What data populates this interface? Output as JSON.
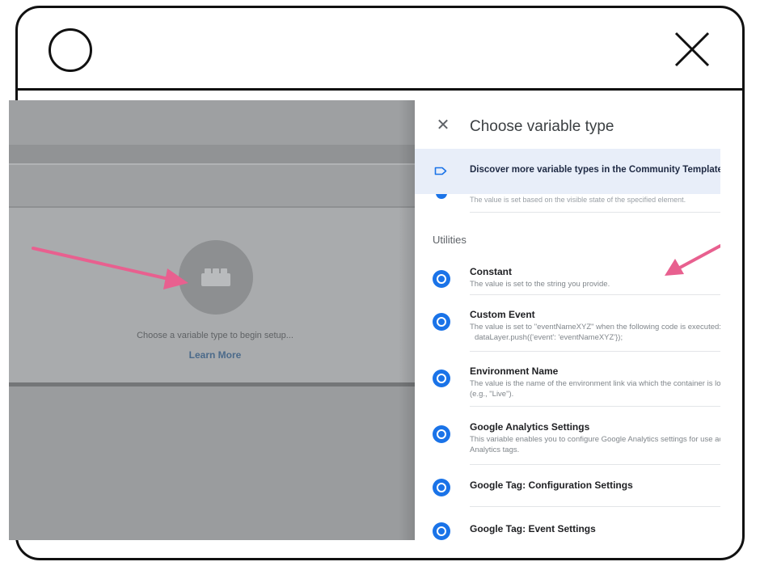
{
  "window": {
    "circle_icon": "circle-icon",
    "close_icon": "close-x-icon"
  },
  "editor": {
    "hint": "Choose a variable type to begin setup...",
    "learn_more": "Learn More",
    "placeholder_icon": "lego-brick-icon"
  },
  "panel": {
    "title": "Choose variable type",
    "close_icon": "close-icon",
    "community": "Discover more variable types in the Community Template Gallery",
    "truncated_desc": "The value is set based on the visible state of the specified element.",
    "section": "Utilities",
    "items": [
      {
        "title": "Constant",
        "desc": [
          "The value is set to the string you provide."
        ]
      },
      {
        "title": "Custom Event",
        "desc": [
          "The value is set to \"eventNameXYZ\" when the following code is executed:",
          "dataLayer.push({'event': 'eventNameXYZ'});"
        ]
      },
      {
        "title": "Environment Name",
        "desc": [
          "The value is the name of the environment link via which the container is loaded",
          "(e.g., \"Live\")."
        ]
      },
      {
        "title": "Google Analytics Settings",
        "desc": [
          "This variable enables you to configure Google Analytics settings for use across",
          "Analytics tags."
        ]
      },
      {
        "title": "Google Tag: Configuration Settings",
        "desc": []
      },
      {
        "title": "Google Tag: Event Settings",
        "desc": []
      }
    ]
  },
  "colors": {
    "accent": "#1a73e8",
    "annotation_arrow": "#e8608f",
    "community_bg": "#e8eef9"
  }
}
